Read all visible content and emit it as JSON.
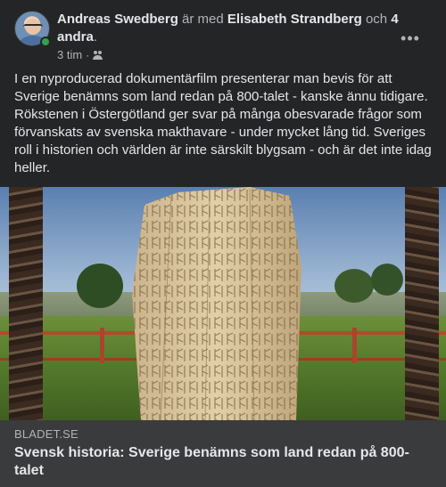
{
  "post": {
    "author": "Andreas Swedberg",
    "with_text": "är med",
    "tagged": "Elisabeth Strandberg",
    "and_text": "och",
    "others": "4 andra",
    "period": ".",
    "time": "3 tim",
    "separator": "·",
    "audience_icon": "friends-icon",
    "more_icon": "more-horizontal-icon",
    "more_label": "•••",
    "body": "I en nyproducerad dokumentärfilm presenterar man bevis för att Sverige benämns som land redan på 800-talet - kanske ännu tidigare. Rökstenen i Östergötland ger svar på många obesvarade frågor som förvanskats av svenska makthavare - under mycket lång tid. Sveriges roll i historien och världen är inte särskilt blygsam - och är det inte idag heller."
  },
  "link": {
    "domain": "BLADET.SE",
    "title": "Svensk historia: Sverige benämns som land redan på 800-talet"
  },
  "colors": {
    "background": "#242526",
    "link_bar": "#3a3b3c",
    "text_primary": "#e4e6eb",
    "text_secondary": "#b0b3b8",
    "online": "#31a24c"
  }
}
